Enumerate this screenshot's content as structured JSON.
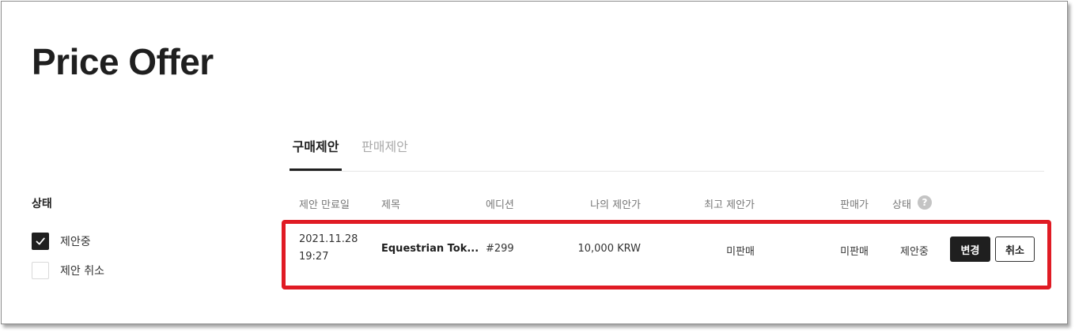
{
  "page": {
    "title": "Price Offer"
  },
  "filter": {
    "title": "상태",
    "options": [
      {
        "label": "제안중",
        "checked": true
      },
      {
        "label": "제안 취소",
        "checked": false
      }
    ]
  },
  "tabs": [
    {
      "label": "구매제안",
      "active": true
    },
    {
      "label": "판매제안",
      "active": false
    }
  ],
  "table": {
    "headers": {
      "expiry": "제안 만료일",
      "title": "제목",
      "edition": "에디션",
      "my_offer": "나의 제안가",
      "top_offer": "최고 제안가",
      "sale_price": "판매가",
      "status": "상태"
    },
    "help_icon": "?",
    "rows": [
      {
        "expiry_date": "2021.11.28",
        "expiry_time": "19:27",
        "title": "Equestrian Tok...",
        "edition": "#299",
        "my_offer": "10,000 KRW",
        "top_offer": "미판매",
        "sale_price": "미판매",
        "status": "제안중",
        "change_label": "변경",
        "cancel_label": "취소"
      }
    ]
  },
  "colors": {
    "accent": "#1f1f1f",
    "highlight": "#e01b24",
    "muted": "#aaaaaa"
  }
}
